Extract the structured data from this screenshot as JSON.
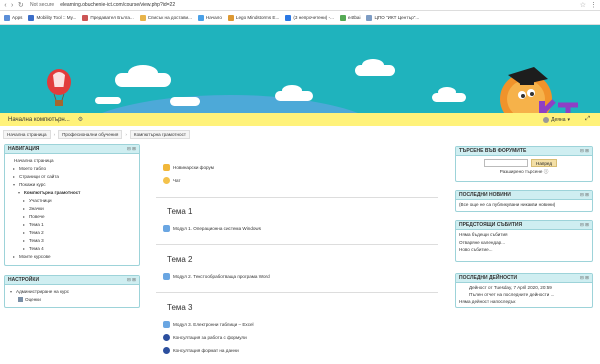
{
  "browser": {
    "secure_label": "Not secure",
    "url": "elearning.obuchenie-ict.com/course/view.php?id=22",
    "bookmarks": [
      {
        "label": "Apps",
        "color": "#5b8fd8"
      },
      {
        "label": "Mobility Tool :: My...",
        "color": "#3b6ec9"
      },
      {
        "label": "Предавател Бълга...",
        "color": "#c55"
      },
      {
        "label": "Списък на достави...",
        "color": "#e8b44a"
      },
      {
        "label": "Начало",
        "color": "#4aa1e8"
      },
      {
        "label": "Lego Mindstorms E...",
        "color": "#d93"
      },
      {
        "label": "(3 непрочетени) -...",
        "color": "#2b78e4"
      },
      {
        "label": "e4tbai",
        "color": "#5a5"
      },
      {
        "label": "ЦПО \"ИКТ Център\"...",
        "color": "#7d9cc4"
      }
    ]
  },
  "navbar": {
    "site_name": "Начална компютърн...",
    "user_name": "Деяна",
    "expand_label": "⤢"
  },
  "breadcrumb": {
    "items": [
      "Начална страница",
      "Професионални обучения",
      "Компютърна грамотност"
    ]
  },
  "navigation": {
    "title": "НАВИГАЦИЯ",
    "items": [
      {
        "label": "Начална страница",
        "indent": 0,
        "arrow": ""
      },
      {
        "label": "Моето табло",
        "indent": 1,
        "arrow": "▸"
      },
      {
        "label": "Страници от сайта",
        "indent": 1,
        "arrow": "▸"
      },
      {
        "label": "Покажи курс",
        "indent": 1,
        "arrow": "▾"
      },
      {
        "label": "Компютърна грамотност",
        "indent": 2,
        "arrow": "▾",
        "bold": true
      },
      {
        "label": "Участници",
        "indent": 3,
        "arrow": "▸"
      },
      {
        "label": "Значки",
        "indent": 3,
        "arrow": "▸"
      },
      {
        "label": "Повече",
        "indent": 3,
        "arrow": "▸"
      },
      {
        "label": "Тема 1",
        "indent": 3,
        "arrow": "▸"
      },
      {
        "label": "Тема 2",
        "indent": 3,
        "arrow": "▸"
      },
      {
        "label": "Тема 3",
        "indent": 3,
        "arrow": "▸"
      },
      {
        "label": "Тема 4",
        "indent": 3,
        "arrow": "▸"
      },
      {
        "label": "Моите курсове",
        "indent": 1,
        "arrow": "▸"
      }
    ]
  },
  "settings": {
    "title": "НАСТРОЙКИ",
    "items": [
      "Администриране на курс",
      "Оценки"
    ]
  },
  "center": {
    "top_items": [
      {
        "label": "Новинарски форум",
        "icon": "forum-icon"
      },
      {
        "label": "Чат",
        "icon": "chat-icon"
      }
    ],
    "topics": [
      {
        "title": "Тема 1",
        "items": [
          {
            "label": "Модул 1. Операционна система Windows",
            "icon": "folder-icon"
          }
        ]
      },
      {
        "title": "Тема 2",
        "items": [
          {
            "label": "Модул 2. Текстообработваща програма Word",
            "icon": "folder-icon"
          }
        ]
      },
      {
        "title": "Тема 3",
        "items": [
          {
            "label": "Модул 3. Електронни таблици – Excel",
            "icon": "folder-icon"
          },
          {
            "label": "Консултация за работа с формули",
            "icon": "bbb-icon"
          },
          {
            "label": "Консултация формат на данни",
            "icon": "bbb-icon"
          }
        ]
      }
    ]
  },
  "forum_search": {
    "title": "ТЪРСЕНЕ ВЪВ ФОРУМИТЕ",
    "button": "Напред",
    "advanced": "Разширено търсене"
  },
  "latest_news": {
    "title": "ПОСЛЕДНИ НОВИНИ",
    "text": "(Все още не са публикувани никакви новини)"
  },
  "upcoming": {
    "title": "ПРЕДСТОЯЩИ СЪБИТИЯ",
    "lines": [
      "Няма бъдещи събития",
      "Отваряне календар...",
      "Ново събитие..."
    ]
  },
  "recent_activity": {
    "title": "ПОСЛЕДНИ ДЕЙНОСТИ",
    "lines": [
      "Дейност от Tuesday, 7 April 2020, 20:59",
      "Пълен отчет на последните дейности ...",
      "Няма дейност напоследък"
    ]
  }
}
